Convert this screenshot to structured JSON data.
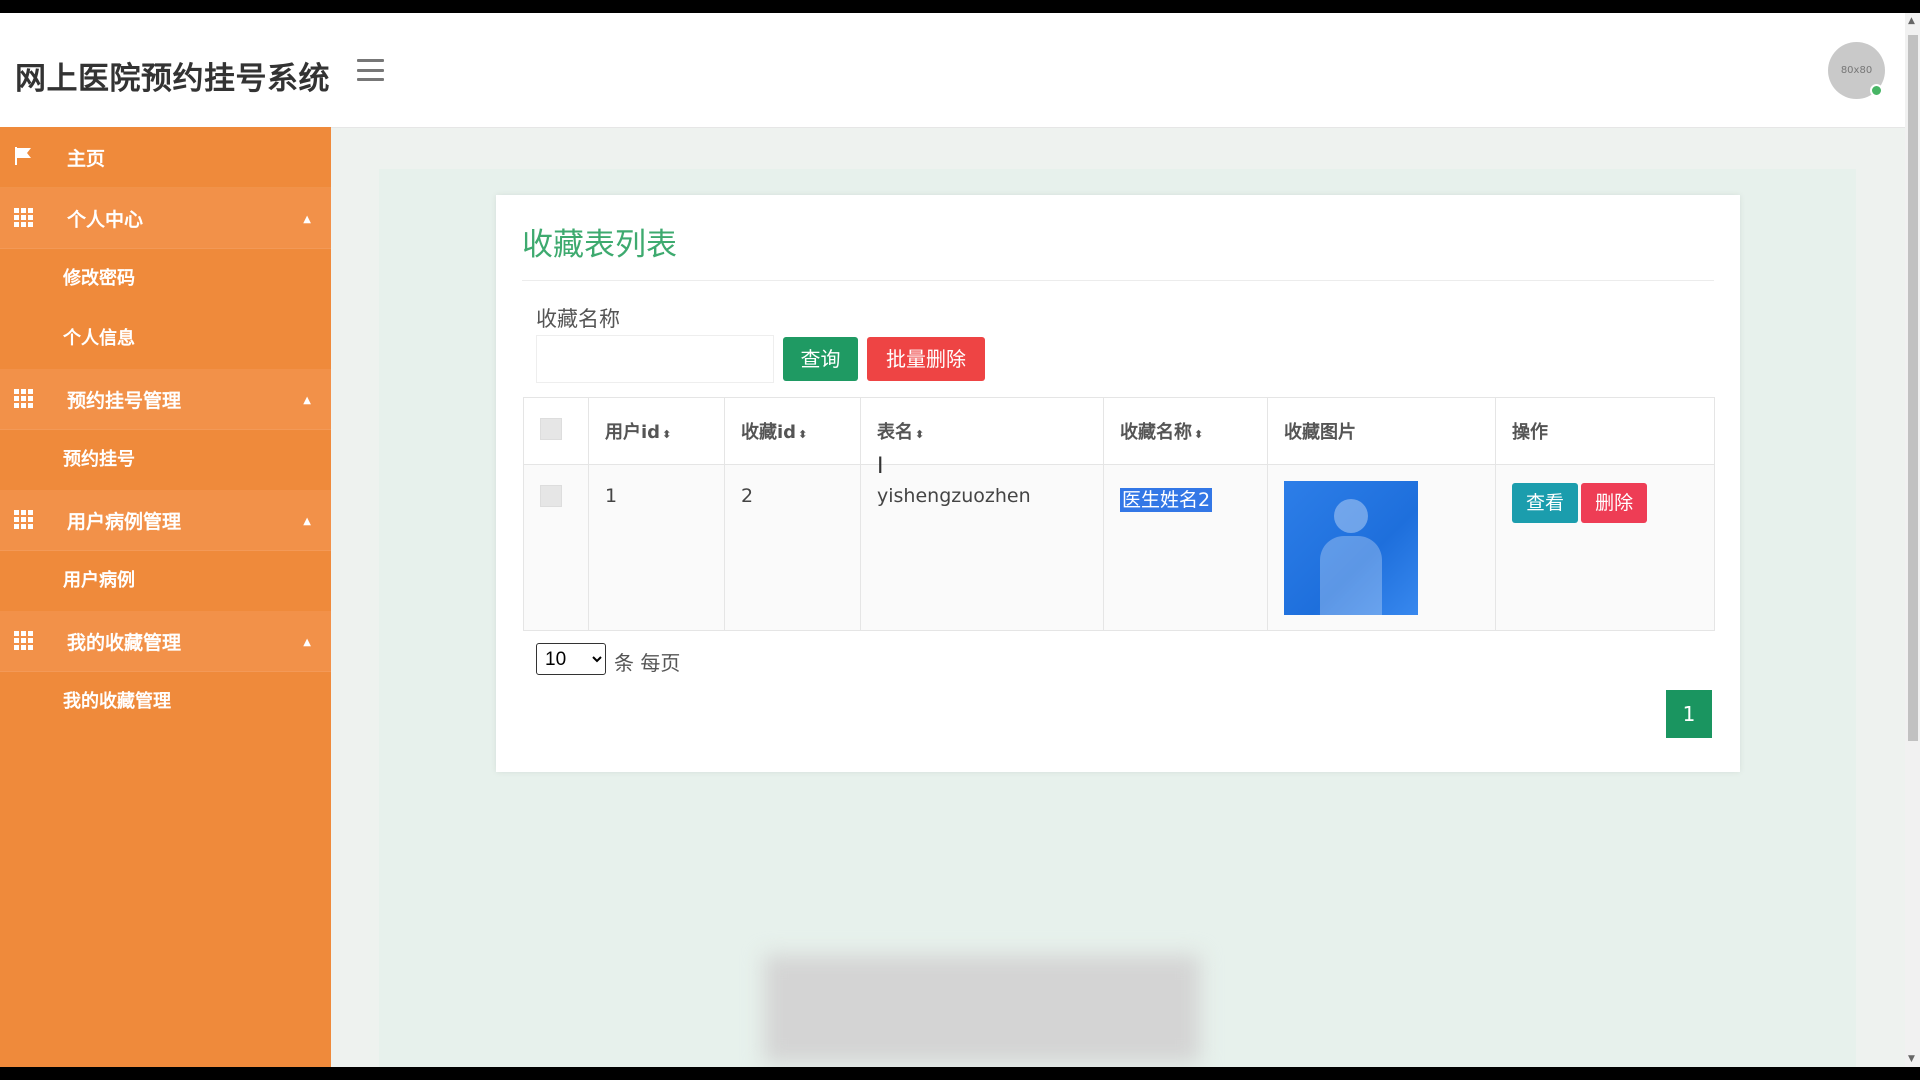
{
  "app": {
    "title": "网上医院预约挂号系统",
    "avatar_text": "80x80"
  },
  "sidebar": {
    "home": "主页",
    "groups": [
      {
        "label": "个人中心",
        "items": [
          "修改密码",
          "个人信息"
        ]
      },
      {
        "label": "预约挂号管理",
        "items": [
          "预约挂号"
        ]
      },
      {
        "label": "用户病例管理",
        "items": [
          "用户病例"
        ]
      },
      {
        "label": "我的收藏管理",
        "items": [
          "我的收藏管理"
        ]
      }
    ]
  },
  "page": {
    "title": "收藏表列表",
    "search_label": "收藏名称",
    "search_value": "",
    "query_button": "查询",
    "batch_delete_button": "批量删除"
  },
  "table": {
    "columns": [
      "用户id",
      "收藏id",
      "表名",
      "收藏名称",
      "收藏图片",
      "操作"
    ],
    "rows": [
      {
        "user_id": "1",
        "fav_id": "2",
        "table_name": "yishengzuozhen",
        "fav_name": "医生姓名2",
        "view": "查看",
        "delete": "删除"
      }
    ]
  },
  "pagination": {
    "page_size": "10",
    "page_size_label": "条 每页",
    "current_page": "1",
    "options": [
      "10"
    ]
  },
  "colors": {
    "sidebar": "#ef8a3b",
    "accent_green": "#3eaa6f",
    "query": "#1f9a63",
    "danger": "#ee4444",
    "view": "#1b9dad"
  }
}
